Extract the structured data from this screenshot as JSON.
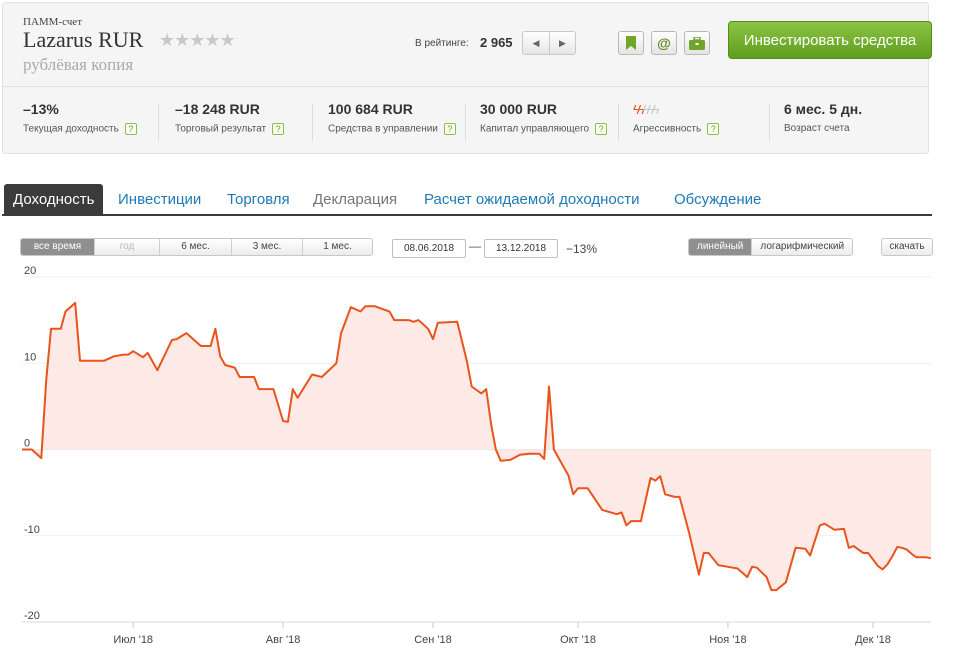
{
  "header": {
    "type_label": "ПАММ-счет",
    "name": "Lazarus RUR",
    "stars": "★★★★★",
    "subtitle": "рублёвая копия",
    "rating_label": "В рейтинге:",
    "rating_value": "2 965",
    "nav_prev": "◀",
    "nav_next": "▶",
    "email_icon": "@",
    "invest_label": "Инвестировать средства",
    "accent": "#6fae2a",
    "line_color": "#e8541c"
  },
  "stats": [
    {
      "value": "–13%",
      "label": "Текущая доходность"
    },
    {
      "value": "–18 248 RUR",
      "label": "Торговый результат"
    },
    {
      "value": "100 684 RUR",
      "label": "Средства в управлении"
    },
    {
      "value": "30 000 RUR",
      "label": "Капитал управляющего"
    },
    {
      "label": "Агрессивность",
      "level": 2,
      "max": 5
    },
    {
      "value": "6 мес. 5 дн.",
      "label": "Возраст счета"
    }
  ],
  "help_mark": "?",
  "tabs": [
    {
      "label": "Доходность",
      "state": "active"
    },
    {
      "label": "Инвестиции",
      "state": "link"
    },
    {
      "label": "Торговля",
      "state": "link"
    },
    {
      "label": "Декларация",
      "state": "disabled"
    },
    {
      "label": "Расчет ожидаемой доходности",
      "state": "link"
    },
    {
      "label": "Обсуждение",
      "state": "link"
    }
  ],
  "toolbar": {
    "periods": [
      {
        "label": "все время",
        "state": "active"
      },
      {
        "label": "год",
        "state": "disabled"
      },
      {
        "label": "6 мес.",
        "state": "normal"
      },
      {
        "label": "3 мес.",
        "state": "normal"
      },
      {
        "label": "1 мес.",
        "state": "normal"
      }
    ],
    "date_from": "08.06.2018",
    "date_dash": "—",
    "date_to": "13.12.2018",
    "period_return": "−13%",
    "scales": [
      {
        "label": "линейный",
        "state": "active"
      },
      {
        "label": "логарифмический",
        "state": "normal"
      }
    ],
    "download_label": "скачать"
  },
  "chart_data": {
    "type": "area",
    "title": "",
    "xlabel": "",
    "ylabel": "",
    "ylim": [
      -20,
      20
    ],
    "yticks": [
      20,
      10,
      0,
      -10,
      -20
    ],
    "xlim": [
      "2018-06-08",
      "2018-12-13"
    ],
    "xticks": [
      {
        "date": "2018-07-01",
        "label": "Июл '18"
      },
      {
        "date": "2018-08-01",
        "label": "Авг '18"
      },
      {
        "date": "2018-09-01",
        "label": "Сен '18"
      },
      {
        "date": "2018-10-01",
        "label": "Окт '18"
      },
      {
        "date": "2018-11-01",
        "label": "Ноя '18"
      },
      {
        "date": "2018-12-01",
        "label": "Дек '18"
      }
    ],
    "grid": true,
    "line_color": "#e8541c",
    "fill_color": "#fde9e6",
    "series": [
      {
        "points": [
          [
            "2018-06-08",
            0
          ],
          [
            "2018-06-10",
            0
          ],
          [
            "2018-06-12",
            -1
          ],
          [
            "2018-06-13",
            8
          ],
          [
            "2018-06-14",
            14
          ],
          [
            "2018-06-16",
            14
          ],
          [
            "2018-06-17",
            16
          ],
          [
            "2018-06-19",
            17
          ],
          [
            "2018-06-20",
            10.3
          ],
          [
            "2018-06-25",
            10.3
          ],
          [
            "2018-06-27",
            10.8
          ],
          [
            "2018-06-29",
            11
          ],
          [
            "2018-06-30",
            11
          ],
          [
            "2018-07-01",
            11.4
          ],
          [
            "2018-07-03",
            10.7
          ],
          [
            "2018-07-04",
            11.2
          ],
          [
            "2018-07-06",
            9.2
          ],
          [
            "2018-07-09",
            12.7
          ],
          [
            "2018-07-10",
            12.8
          ],
          [
            "2018-07-12",
            13.5
          ],
          [
            "2018-07-15",
            12
          ],
          [
            "2018-07-17",
            12
          ],
          [
            "2018-07-18",
            14
          ],
          [
            "2018-07-19",
            10.8
          ],
          [
            "2018-07-20",
            9.8
          ],
          [
            "2018-07-22",
            9.5
          ],
          [
            "2018-07-23",
            8.4
          ],
          [
            "2018-07-26",
            8.4
          ],
          [
            "2018-07-27",
            7
          ],
          [
            "2018-07-30",
            7
          ],
          [
            "2018-08-01",
            3.3
          ],
          [
            "2018-08-02",
            3.2
          ],
          [
            "2018-08-03",
            7
          ],
          [
            "2018-08-04",
            6
          ],
          [
            "2018-08-07",
            8.7
          ],
          [
            "2018-08-09",
            8.4
          ],
          [
            "2018-08-12",
            10
          ],
          [
            "2018-08-13",
            13.5
          ],
          [
            "2018-08-15",
            16.5
          ],
          [
            "2018-08-17",
            16
          ],
          [
            "2018-08-18",
            16.6
          ],
          [
            "2018-08-20",
            16.6
          ],
          [
            "2018-08-21",
            16.4
          ],
          [
            "2018-08-23",
            16
          ],
          [
            "2018-08-24",
            15
          ],
          [
            "2018-08-27",
            15
          ],
          [
            "2018-08-28",
            14.8
          ],
          [
            "2018-08-29",
            15
          ],
          [
            "2018-08-30",
            14.5
          ],
          [
            "2018-08-31",
            14
          ],
          [
            "2018-09-01",
            12.8
          ],
          [
            "2018-09-02",
            14.7
          ],
          [
            "2018-09-06",
            14.8
          ],
          [
            "2018-09-08",
            10.3
          ],
          [
            "2018-09-09",
            7.3
          ],
          [
            "2018-09-11",
            6.5
          ],
          [
            "2018-09-12",
            7
          ],
          [
            "2018-09-13",
            3
          ],
          [
            "2018-09-14",
            0
          ],
          [
            "2018-09-15",
            -1.3
          ],
          [
            "2018-09-17",
            -1.2
          ],
          [
            "2018-09-19",
            -0.6
          ],
          [
            "2018-09-21",
            -0.5
          ],
          [
            "2018-09-23",
            -0.5
          ],
          [
            "2018-09-24",
            -1.1
          ],
          [
            "2018-09-25",
            7.3
          ],
          [
            "2018-09-26",
            0
          ],
          [
            "2018-09-28",
            -2
          ],
          [
            "2018-09-29",
            -3
          ],
          [
            "2018-09-30",
            -5.2
          ],
          [
            "2018-10-01",
            -4.5
          ],
          [
            "2018-10-03",
            -4.5
          ],
          [
            "2018-10-06",
            -7
          ],
          [
            "2018-10-09",
            -7.5
          ],
          [
            "2018-10-10",
            -7.3
          ],
          [
            "2018-10-11",
            -8.8
          ],
          [
            "2018-10-12",
            -8.3
          ],
          [
            "2018-10-14",
            -8.3
          ],
          [
            "2018-10-16",
            -3.3
          ],
          [
            "2018-10-17",
            -3.6
          ],
          [
            "2018-10-18",
            -3.1
          ],
          [
            "2018-10-19",
            -5.2
          ],
          [
            "2018-10-21",
            -5.5
          ],
          [
            "2018-10-22",
            -5.5
          ],
          [
            "2018-10-24",
            -9.7
          ],
          [
            "2018-10-26",
            -14.5
          ],
          [
            "2018-10-27",
            -12
          ],
          [
            "2018-10-28",
            -12
          ],
          [
            "2018-10-30",
            -13.4
          ],
          [
            "2018-11-01",
            -13.6
          ],
          [
            "2018-11-03",
            -13.8
          ],
          [
            "2018-11-05",
            -14.8
          ],
          [
            "2018-11-06",
            -13.6
          ],
          [
            "2018-11-07",
            -13.7
          ],
          [
            "2018-11-09",
            -14.8
          ],
          [
            "2018-11-10",
            -16.3
          ],
          [
            "2018-11-11",
            -16.3
          ],
          [
            "2018-11-13",
            -15.4
          ],
          [
            "2018-11-15",
            -11.4
          ],
          [
            "2018-11-17",
            -11.5
          ],
          [
            "2018-11-18",
            -12.3
          ],
          [
            "2018-11-20",
            -8.8
          ],
          [
            "2018-11-21",
            -8.6
          ],
          [
            "2018-11-23",
            -9.3
          ],
          [
            "2018-11-25",
            -9.2
          ],
          [
            "2018-11-26",
            -11.4
          ],
          [
            "2018-11-27",
            -11.2
          ],
          [
            "2018-11-29",
            -12
          ],
          [
            "2018-11-30",
            -12
          ],
          [
            "2018-12-02",
            -13.5
          ],
          [
            "2018-12-03",
            -13.9
          ],
          [
            "2018-12-04",
            -13.3
          ],
          [
            "2018-12-05",
            -12.4
          ],
          [
            "2018-12-06",
            -11.3
          ],
          [
            "2018-12-07",
            -11.4
          ],
          [
            "2018-12-08",
            -11.6
          ],
          [
            "2018-12-09",
            -12.1
          ],
          [
            "2018-12-10",
            -12.5
          ],
          [
            "2018-12-12",
            -12.5
          ],
          [
            "2018-12-13",
            -12.6
          ]
        ]
      }
    ]
  }
}
